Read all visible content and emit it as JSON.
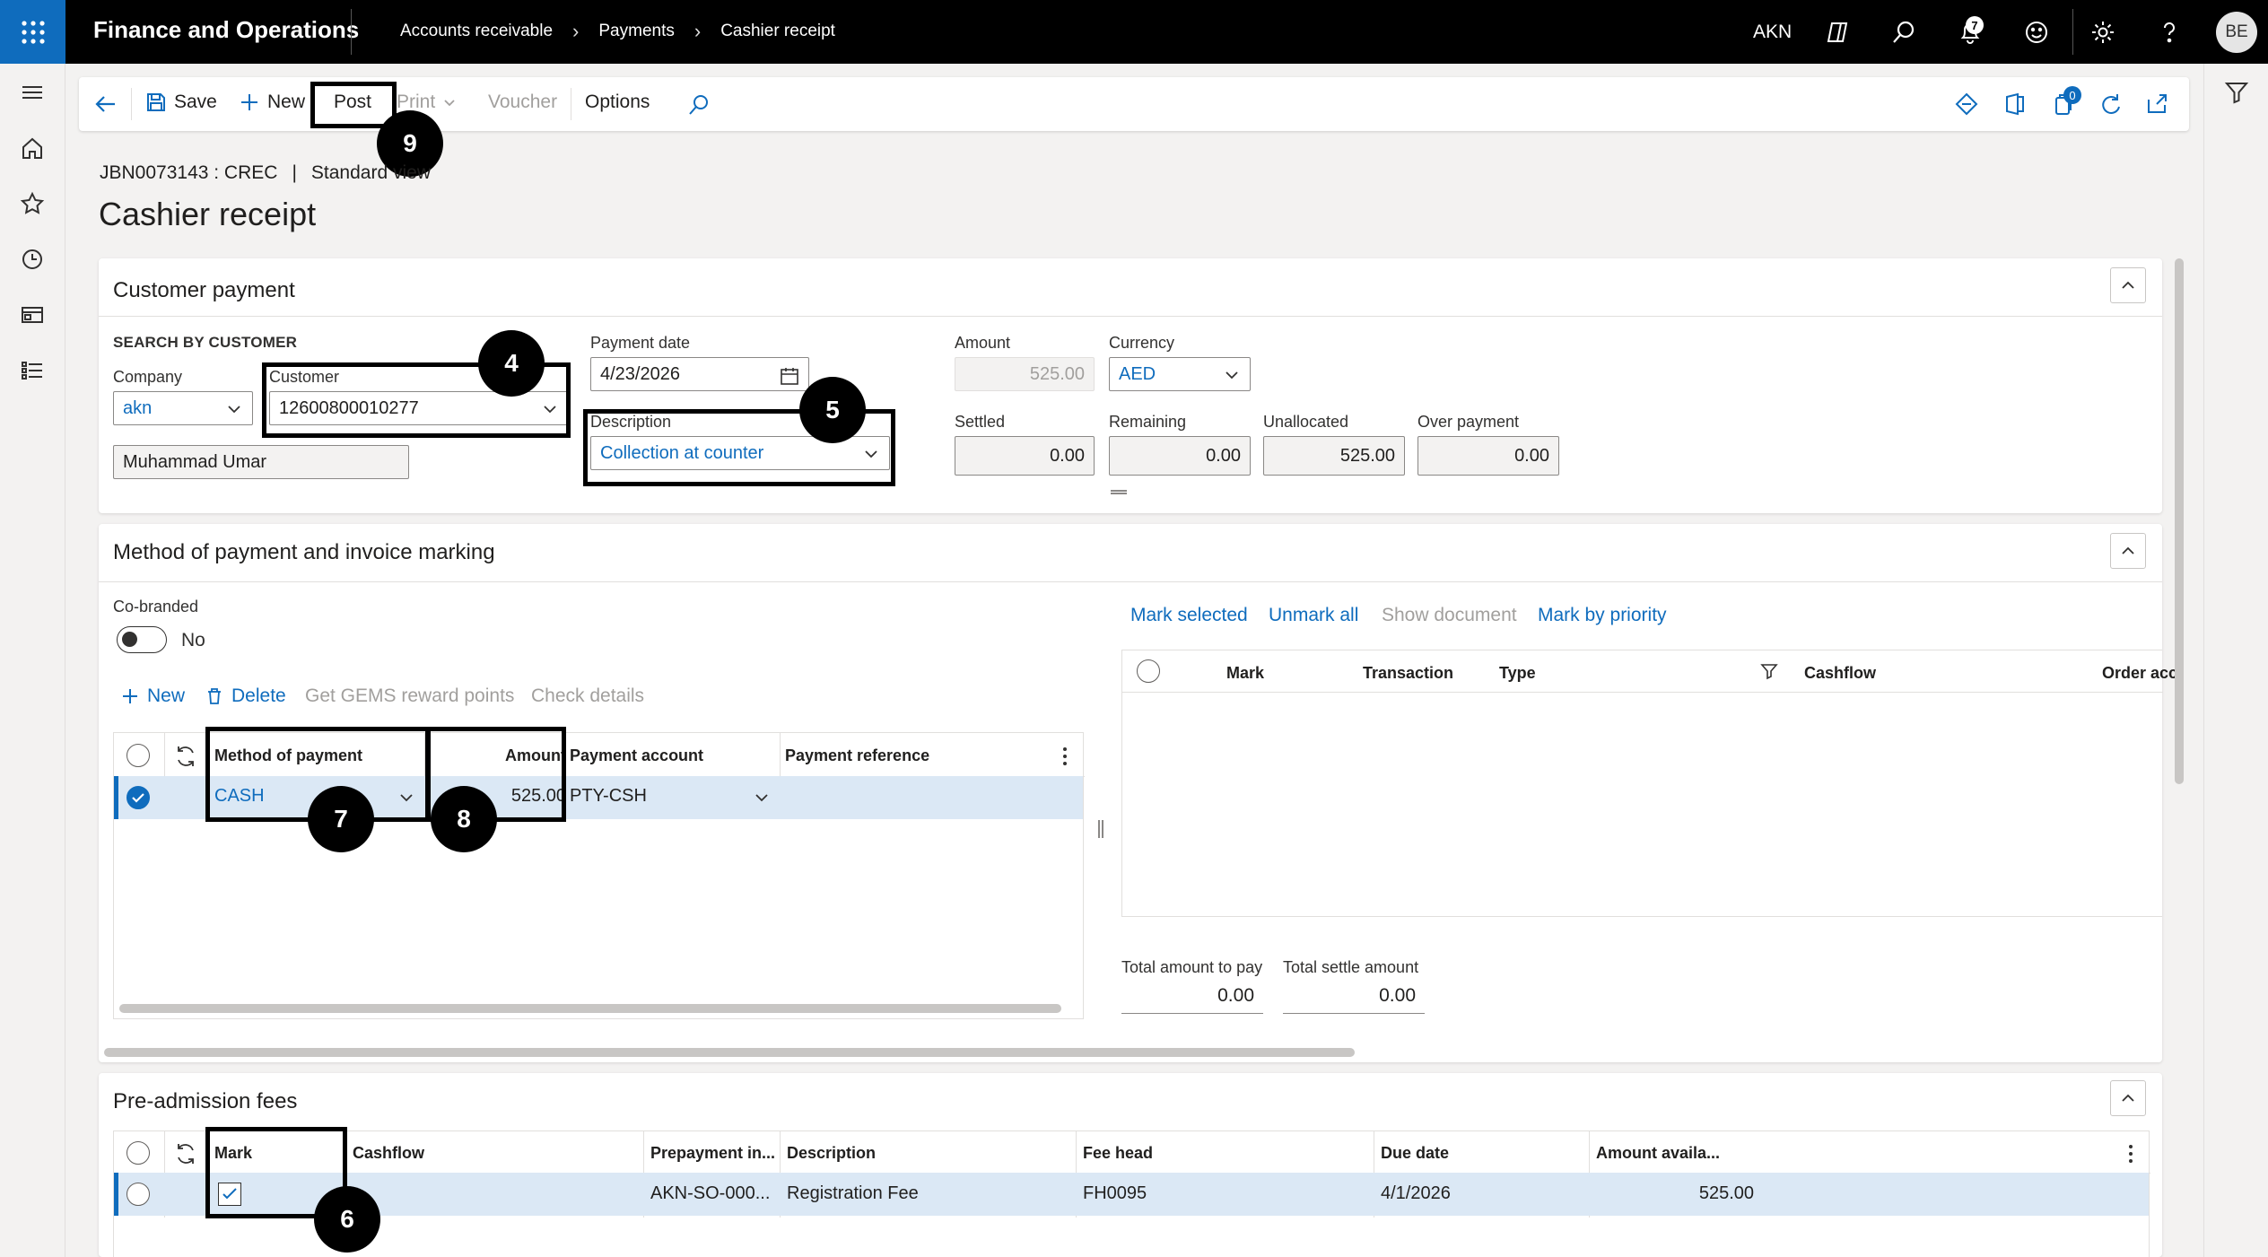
{
  "topbar": {
    "app_name": "Finance and Operations",
    "breadcrumbs": [
      "Accounts receivable",
      "Payments",
      "Cashier receipt"
    ],
    "company": "AKN",
    "notification_count": "7",
    "user_initials": "BE"
  },
  "actions": {
    "save": "Save",
    "new": "New",
    "post": "Post",
    "print": "Print",
    "voucher": "Voucher",
    "options": "Options",
    "attachments_count": "0"
  },
  "header": {
    "record": "JBN0073143 : CREC",
    "divider": "|",
    "view": "Standard view",
    "title": "Cashier receipt"
  },
  "customer_payment": {
    "title": "Customer payment",
    "search_heading": "SEARCH BY CUSTOMER",
    "company_label": "Company",
    "company_value": "akn",
    "customer_label": "Customer",
    "customer_value": "12600800010277",
    "customer_name": "Muhammad Umar",
    "payment_date_label": "Payment date",
    "payment_date_value": "4/23/2026",
    "description_label": "Description",
    "description_value": "Collection at counter",
    "amount_label": "Amount",
    "amount_value": "525.00",
    "currency_label": "Currency",
    "currency_value": "AED",
    "settled_label": "Settled",
    "settled_value": "0.00",
    "remaining_label": "Remaining",
    "remaining_value": "0.00",
    "unallocated_label": "Unallocated",
    "unallocated_value": "525.00",
    "overpayment_label": "Over payment",
    "overpayment_value": "0.00"
  },
  "method_section": {
    "title": "Method of payment and invoice marking",
    "cobranded_label": "Co-branded",
    "cobranded_value": "No",
    "toolbar": {
      "new": "New",
      "delete": "Delete",
      "gems": "Get GEMS reward points",
      "check": "Check details"
    },
    "columns": [
      "Method of payment",
      "Amount",
      "Payment account",
      "Payment reference"
    ],
    "row": {
      "method": "CASH",
      "amount": "525.00",
      "account": "PTY-CSH",
      "reference": ""
    },
    "marking_toolbar": {
      "mark_selected": "Mark selected",
      "unmark_all": "Unmark all",
      "show_document": "Show document",
      "mark_by_priority": "Mark by priority"
    },
    "marking_columns": [
      "Mark",
      "Transaction",
      "Type",
      "Cashflow",
      "Order acc"
    ],
    "total_to_pay_label": "Total amount to pay",
    "total_to_pay_value": "0.00",
    "total_settle_label": "Total settle amount",
    "total_settle_value": "0.00"
  },
  "preadmission": {
    "title": "Pre-admission fees",
    "columns": [
      "Mark",
      "Cashflow",
      "Prepayment in...",
      "Description",
      "Fee head",
      "Due date",
      "Amount availa..."
    ],
    "row": {
      "cashflow": "",
      "prepayment": "AKN-SO-000...",
      "description": "Registration Fee",
      "fee_head": "FH0095",
      "due_date": "4/1/2026",
      "amount": "525.00"
    }
  },
  "callouts": [
    "4",
    "5",
    "6",
    "7",
    "8",
    "9"
  ],
  "colors": {
    "accent": "#0f6cbd",
    "topbar": "#000000",
    "selected_row": "#dbe8f5"
  }
}
